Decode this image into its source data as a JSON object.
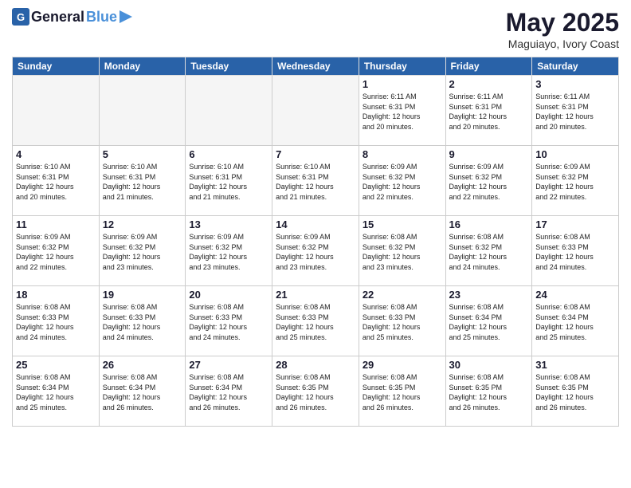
{
  "header": {
    "logo_general": "General",
    "logo_blue": "Blue",
    "month_title": "May 2025",
    "location": "Maguiayo, Ivory Coast"
  },
  "weekdays": [
    "Sunday",
    "Monday",
    "Tuesday",
    "Wednesday",
    "Thursday",
    "Friday",
    "Saturday"
  ],
  "weeks": [
    [
      {
        "day": "",
        "info": ""
      },
      {
        "day": "",
        "info": ""
      },
      {
        "day": "",
        "info": ""
      },
      {
        "day": "",
        "info": ""
      },
      {
        "day": "1",
        "info": "Sunrise: 6:11 AM\nSunset: 6:31 PM\nDaylight: 12 hours\nand 20 minutes."
      },
      {
        "day": "2",
        "info": "Sunrise: 6:11 AM\nSunset: 6:31 PM\nDaylight: 12 hours\nand 20 minutes."
      },
      {
        "day": "3",
        "info": "Sunrise: 6:11 AM\nSunset: 6:31 PM\nDaylight: 12 hours\nand 20 minutes."
      }
    ],
    [
      {
        "day": "4",
        "info": "Sunrise: 6:10 AM\nSunset: 6:31 PM\nDaylight: 12 hours\nand 20 minutes."
      },
      {
        "day": "5",
        "info": "Sunrise: 6:10 AM\nSunset: 6:31 PM\nDaylight: 12 hours\nand 21 minutes."
      },
      {
        "day": "6",
        "info": "Sunrise: 6:10 AM\nSunset: 6:31 PM\nDaylight: 12 hours\nand 21 minutes."
      },
      {
        "day": "7",
        "info": "Sunrise: 6:10 AM\nSunset: 6:31 PM\nDaylight: 12 hours\nand 21 minutes."
      },
      {
        "day": "8",
        "info": "Sunrise: 6:09 AM\nSunset: 6:32 PM\nDaylight: 12 hours\nand 22 minutes."
      },
      {
        "day": "9",
        "info": "Sunrise: 6:09 AM\nSunset: 6:32 PM\nDaylight: 12 hours\nand 22 minutes."
      },
      {
        "day": "10",
        "info": "Sunrise: 6:09 AM\nSunset: 6:32 PM\nDaylight: 12 hours\nand 22 minutes."
      }
    ],
    [
      {
        "day": "11",
        "info": "Sunrise: 6:09 AM\nSunset: 6:32 PM\nDaylight: 12 hours\nand 22 minutes."
      },
      {
        "day": "12",
        "info": "Sunrise: 6:09 AM\nSunset: 6:32 PM\nDaylight: 12 hours\nand 23 minutes."
      },
      {
        "day": "13",
        "info": "Sunrise: 6:09 AM\nSunset: 6:32 PM\nDaylight: 12 hours\nand 23 minutes."
      },
      {
        "day": "14",
        "info": "Sunrise: 6:09 AM\nSunset: 6:32 PM\nDaylight: 12 hours\nand 23 minutes."
      },
      {
        "day": "15",
        "info": "Sunrise: 6:08 AM\nSunset: 6:32 PM\nDaylight: 12 hours\nand 23 minutes."
      },
      {
        "day": "16",
        "info": "Sunrise: 6:08 AM\nSunset: 6:32 PM\nDaylight: 12 hours\nand 24 minutes."
      },
      {
        "day": "17",
        "info": "Sunrise: 6:08 AM\nSunset: 6:33 PM\nDaylight: 12 hours\nand 24 minutes."
      }
    ],
    [
      {
        "day": "18",
        "info": "Sunrise: 6:08 AM\nSunset: 6:33 PM\nDaylight: 12 hours\nand 24 minutes."
      },
      {
        "day": "19",
        "info": "Sunrise: 6:08 AM\nSunset: 6:33 PM\nDaylight: 12 hours\nand 24 minutes."
      },
      {
        "day": "20",
        "info": "Sunrise: 6:08 AM\nSunset: 6:33 PM\nDaylight: 12 hours\nand 24 minutes."
      },
      {
        "day": "21",
        "info": "Sunrise: 6:08 AM\nSunset: 6:33 PM\nDaylight: 12 hours\nand 25 minutes."
      },
      {
        "day": "22",
        "info": "Sunrise: 6:08 AM\nSunset: 6:33 PM\nDaylight: 12 hours\nand 25 minutes."
      },
      {
        "day": "23",
        "info": "Sunrise: 6:08 AM\nSunset: 6:34 PM\nDaylight: 12 hours\nand 25 minutes."
      },
      {
        "day": "24",
        "info": "Sunrise: 6:08 AM\nSunset: 6:34 PM\nDaylight: 12 hours\nand 25 minutes."
      }
    ],
    [
      {
        "day": "25",
        "info": "Sunrise: 6:08 AM\nSunset: 6:34 PM\nDaylight: 12 hours\nand 25 minutes."
      },
      {
        "day": "26",
        "info": "Sunrise: 6:08 AM\nSunset: 6:34 PM\nDaylight: 12 hours\nand 26 minutes."
      },
      {
        "day": "27",
        "info": "Sunrise: 6:08 AM\nSunset: 6:34 PM\nDaylight: 12 hours\nand 26 minutes."
      },
      {
        "day": "28",
        "info": "Sunrise: 6:08 AM\nSunset: 6:35 PM\nDaylight: 12 hours\nand 26 minutes."
      },
      {
        "day": "29",
        "info": "Sunrise: 6:08 AM\nSunset: 6:35 PM\nDaylight: 12 hours\nand 26 minutes."
      },
      {
        "day": "30",
        "info": "Sunrise: 6:08 AM\nSunset: 6:35 PM\nDaylight: 12 hours\nand 26 minutes."
      },
      {
        "day": "31",
        "info": "Sunrise: 6:08 AM\nSunset: 6:35 PM\nDaylight: 12 hours\nand 26 minutes."
      }
    ]
  ]
}
